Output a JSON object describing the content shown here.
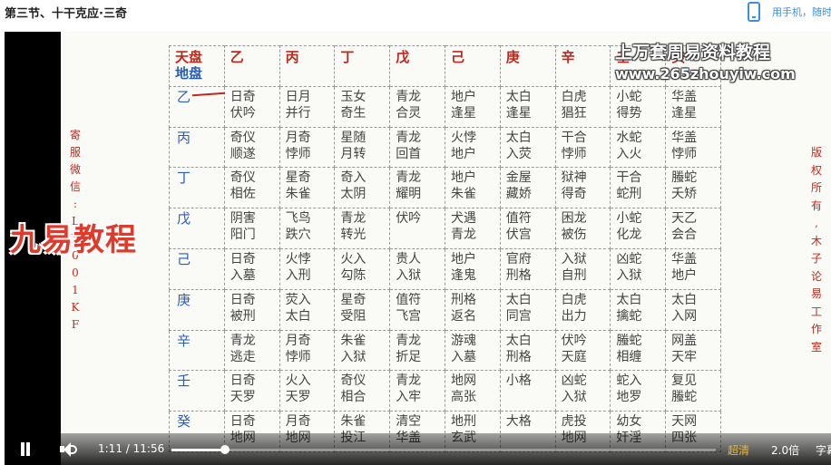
{
  "page": {
    "title": "第三节、十干克应·三奇",
    "mobile_link": "用手机，随时"
  },
  "video": {
    "side_left": [
      "寄",
      "服",
      "微",
      "信",
      ":",
      "L",
      "Y",
      "0",
      "0",
      "1",
      "K",
      "F"
    ],
    "side_right": [
      "版",
      "权",
      "所",
      "有",
      ",",
      "木",
      "子",
      "论",
      "易",
      "工",
      "作",
      "室"
    ],
    "brand": "九易教程",
    "watermark_title": "上万套周易资料教程",
    "watermark_url": "www.265zhouyiw.com",
    "table": {
      "corner_top": "天盘",
      "corner_bottom": "地盘",
      "columns": [
        "乙",
        "丙",
        "丁",
        "戊",
        "己",
        "庚",
        "辛",
        "壬",
        "癸"
      ],
      "rows": [
        {
          "head": "乙",
          "cells": [
            [
              "日奇",
              "伏吟"
            ],
            [
              "日月",
              "并行"
            ],
            [
              "玉女",
              "奇生"
            ],
            [
              "青龙",
              "合灵"
            ],
            [
              "地户",
              "逢星"
            ],
            [
              "太白",
              "逢星"
            ],
            [
              "白虎",
              "猖狂"
            ],
            [
              "小蛇",
              "得势"
            ],
            [
              "华盖",
              "逢星"
            ]
          ]
        },
        {
          "head": "丙",
          "cells": [
            [
              "奇仪",
              "顺遂"
            ],
            [
              "月奇",
              "悖师"
            ],
            [
              "星随",
              "月转"
            ],
            [
              "青龙",
              "回首"
            ],
            [
              "火悖",
              "地户"
            ],
            [
              "太白",
              "入荧"
            ],
            [
              "干合",
              "悖师"
            ],
            [
              "水蛇",
              "入火"
            ],
            [
              "华盖",
              "悖师"
            ]
          ]
        },
        {
          "head": "丁",
          "cells": [
            [
              "奇仪",
              "相佐"
            ],
            [
              "星奇",
              "朱雀"
            ],
            [
              "奇入",
              "太阴"
            ],
            [
              "青龙",
              "耀明"
            ],
            [
              "地户",
              "朱雀"
            ],
            [
              "金屋",
              "藏娇"
            ],
            [
              "狱神",
              "得奇"
            ],
            [
              "干合",
              "蛇刑"
            ],
            [
              "螣蛇",
              "夭矫"
            ]
          ]
        },
        {
          "head": "戊",
          "cells": [
            [
              "阴害",
              "阳门"
            ],
            [
              "飞鸟",
              "跌穴"
            ],
            [
              "青龙",
              "转光"
            ],
            [
              "伏吟",
              ""
            ],
            [
              "犬遇",
              "青龙"
            ],
            [
              "值符",
              "伏宫"
            ],
            [
              "困龙",
              "被伤"
            ],
            [
              "小蛇",
              "化龙"
            ],
            [
              "天乙",
              "会合"
            ]
          ]
        },
        {
          "head": "己",
          "cells": [
            [
              "日奇",
              "入墓"
            ],
            [
              "火悖",
              "入刑"
            ],
            [
              "火入",
              "勾陈"
            ],
            [
              "贵人",
              "入狱"
            ],
            [
              "地户",
              "逢鬼"
            ],
            [
              "官府",
              "刑格"
            ],
            [
              "入狱",
              "自刑"
            ],
            [
              "凶蛇",
              "入狱"
            ],
            [
              "华盖",
              "地户"
            ]
          ]
        },
        {
          "head": "庚",
          "cells": [
            [
              "日奇",
              "被刑"
            ],
            [
              "荧入",
              "太白"
            ],
            [
              "星奇",
              "受阻"
            ],
            [
              "值符",
              "飞宫"
            ],
            [
              "刑格",
              "返名"
            ],
            [
              "太白",
              "同宫"
            ],
            [
              "白虎",
              "出力"
            ],
            [
              "太白",
              "擒蛇"
            ],
            [
              "太白",
              "入网"
            ]
          ]
        },
        {
          "head": "辛",
          "cells": [
            [
              "青龙",
              "逃走"
            ],
            [
              "月奇",
              "悖师"
            ],
            [
              "朱雀",
              "入狱"
            ],
            [
              "青龙",
              "折足"
            ],
            [
              "游魂",
              "入墓"
            ],
            [
              "太白",
              "刑格"
            ],
            [
              "伏吟",
              "天庭"
            ],
            [
              "螣蛇",
              "相缠"
            ],
            [
              "网盖",
              "天牢"
            ]
          ]
        },
        {
          "head": "壬",
          "cells": [
            [
              "日奇",
              "天罗"
            ],
            [
              "火入",
              "天罗"
            ],
            [
              "奇仪",
              "相合"
            ],
            [
              "青龙",
              "入牢"
            ],
            [
              "地网",
              "高张"
            ],
            [
              "小格",
              ""
            ],
            [
              "凶蛇",
              "入狱"
            ],
            [
              "蛇入",
              "地罗"
            ],
            [
              "复见",
              "螣蛇"
            ]
          ]
        },
        {
          "head": "癸",
          "cells": [
            [
              "日奇",
              "地网"
            ],
            [
              "月奇",
              "地网"
            ],
            [
              "朱雀",
              "投江"
            ],
            [
              "清空",
              "华盖"
            ],
            [
              "地刑",
              "玄武"
            ],
            [
              "大格",
              ""
            ],
            [
              "虎投",
              "地网"
            ],
            [
              "幼女",
              "奸淫"
            ],
            [
              "天网",
              "四张"
            ]
          ]
        }
      ]
    }
  },
  "controls": {
    "current_time": "1:11",
    "separator": "/",
    "duration": "11:56",
    "progress": 0.099,
    "quality": "超清",
    "speed": "2.0倍",
    "subtitle": "字幕"
  }
}
